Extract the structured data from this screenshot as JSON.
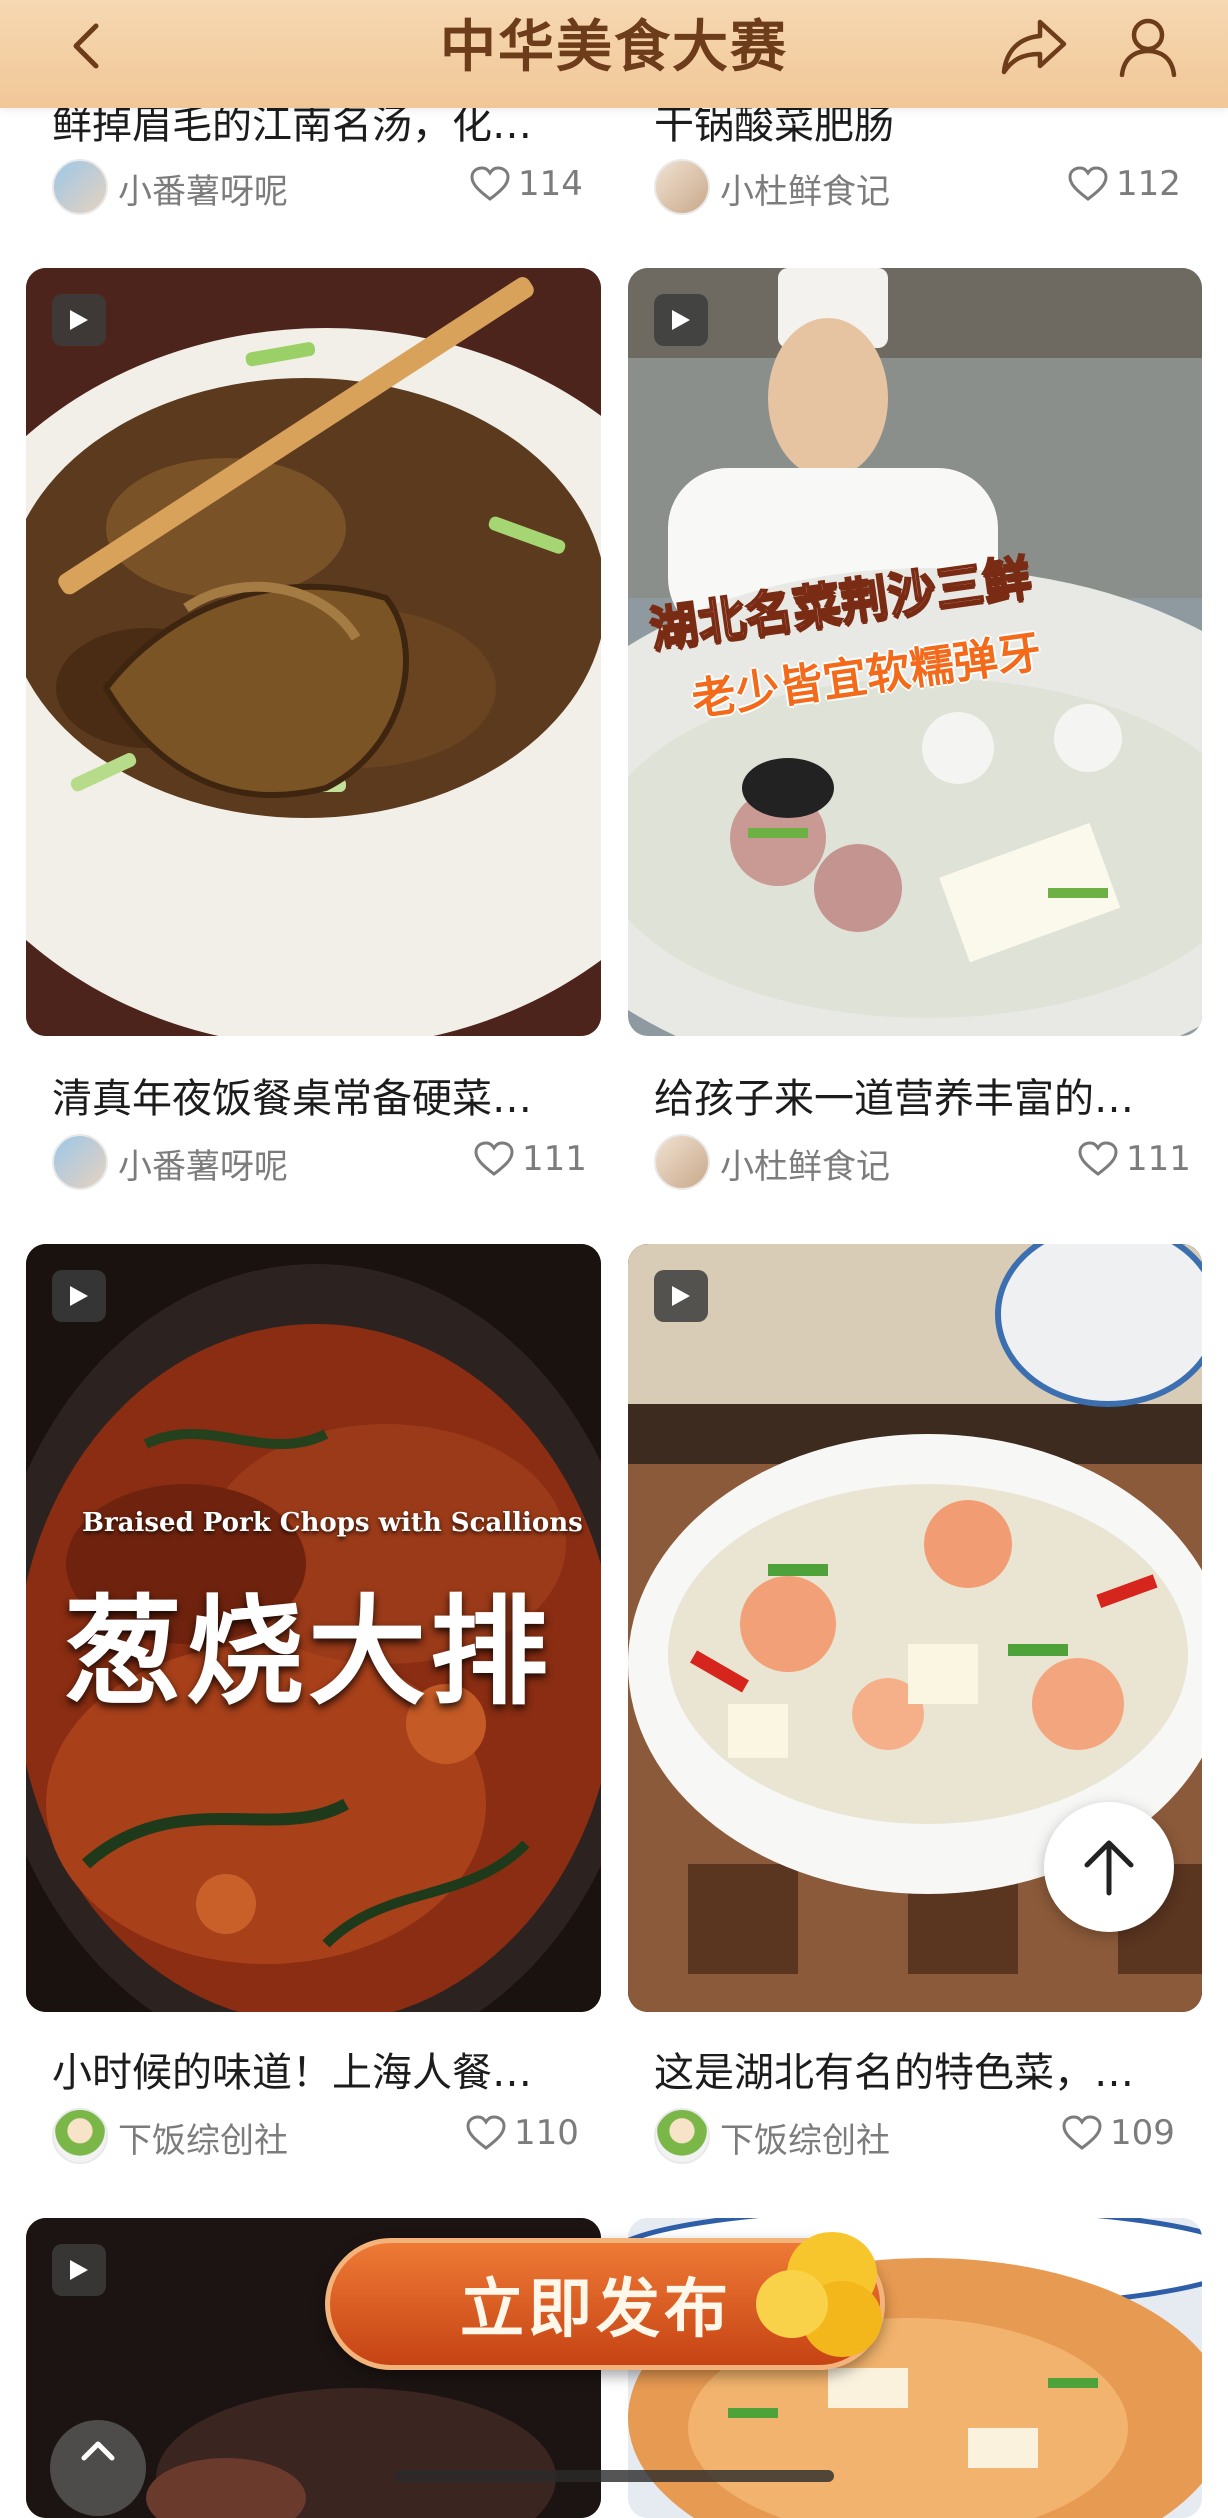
{
  "header": {
    "title": "中华美食大赛"
  },
  "top_row": [
    {
      "caption": "鲜掉眉毛的江南名汤，化…",
      "author": "小番薯呀呢",
      "likes": "114"
    },
    {
      "caption": "干锅酸菜肥肠",
      "author": "小杜鲜食记",
      "likes": "112"
    }
  ],
  "cards": [
    {
      "caption": "清真年夜饭餐桌常备硬菜…",
      "author": "小番薯呀呢",
      "likes": "111"
    },
    {
      "caption": "给孩子来一道营养丰富的…",
      "author": "小杜鲜食记",
      "likes": "111",
      "overlay_line1": "湖北名菜荆沙三鲜",
      "overlay_line2": "老少皆宜软糯弹牙"
    },
    {
      "caption": "小时候的味道！上海人餐…",
      "author": "下饭综创社",
      "likes": "110",
      "overlay_en": "Braised Pork Chops with Scallions",
      "overlay_cn": "葱烧大排"
    },
    {
      "caption": "这是湖北有名的特色菜，…",
      "author": "下饭综创社",
      "likes": "109"
    }
  ],
  "publish_button": "立即发布",
  "colors": {
    "header_bg": "#f1c797",
    "title": "#6d3c1a",
    "publish": "#d85a22"
  }
}
